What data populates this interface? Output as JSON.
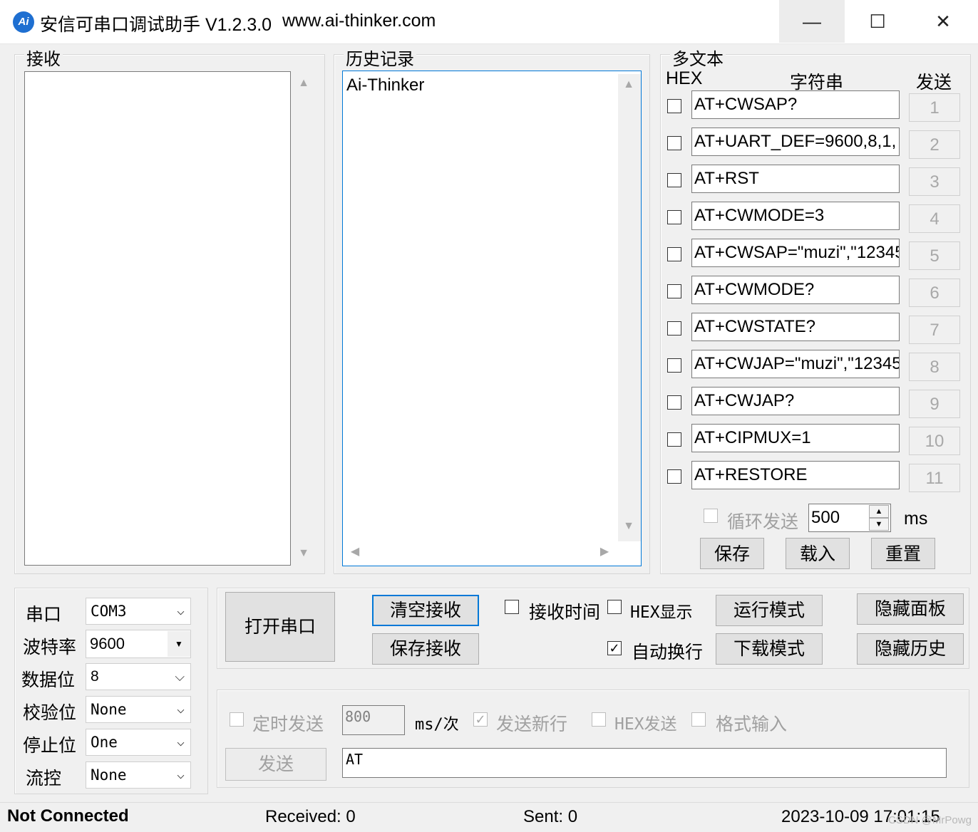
{
  "window": {
    "title": "安信可串口调试助手 V1.2.3.0",
    "url": "www.ai-thinker.com",
    "icon_text": "Ai",
    "minimize_glyph": "—",
    "maximize_glyph": "☐",
    "close_glyph": "✕"
  },
  "receive": {
    "legend": "接收",
    "content": ""
  },
  "history": {
    "legend": "历史记录",
    "content": "Ai-Thinker"
  },
  "multi_text": {
    "legend": "多文本",
    "hex_header": "HEX",
    "string_header": "字符串",
    "send_header": "发送",
    "rows": [
      {
        "cmd": "AT+CWSAP?",
        "num": "1"
      },
      {
        "cmd": "AT+UART_DEF=9600,8,1,",
        "num": "2"
      },
      {
        "cmd": "AT+RST",
        "num": "3"
      },
      {
        "cmd": "AT+CWMODE=3",
        "num": "4"
      },
      {
        "cmd": "AT+CWSAP=\"muzi\",\"12345",
        "num": "5"
      },
      {
        "cmd": "AT+CWMODE?",
        "num": "6"
      },
      {
        "cmd": "AT+CWSTATE?",
        "num": "7"
      },
      {
        "cmd": "AT+CWJAP=\"muzi\",\"12345",
        "num": "8"
      },
      {
        "cmd": "AT+CWJAP?",
        "num": "9"
      },
      {
        "cmd": "AT+CIPMUX=1",
        "num": "10"
      },
      {
        "cmd": "AT+RESTORE",
        "num": "11"
      }
    ],
    "loop_send_label": "循环发送",
    "loop_interval": "500",
    "loop_unit": "ms",
    "save_btn": "保存",
    "load_btn": "载入",
    "reset_btn": "重置"
  },
  "port_settings": {
    "port_label": "串口",
    "port_value": "COM3",
    "baud_label": "波特率",
    "baud_value": "9600",
    "databits_label": "数据位",
    "databits_value": "8",
    "parity_label": "校验位",
    "parity_value": "None",
    "stopbits_label": "停止位",
    "stopbits_value": "One",
    "flow_label": "流控",
    "flow_value": "None"
  },
  "controls": {
    "open_port_btn": "打开串口",
    "clear_receive_btn": "清空接收",
    "save_receive_btn": "保存接收",
    "receive_time_label": "接收时间",
    "receive_time_checked": false,
    "hex_display_label": "HEX显示",
    "hex_display_checked": false,
    "auto_newline_label": "自动换行",
    "auto_newline_checked": true,
    "run_mode_btn": "运行模式",
    "download_mode_btn": "下载模式",
    "hide_panel_btn": "隐藏面板",
    "hide_history_btn": "隐藏历史"
  },
  "send_area": {
    "timed_send_label": "定时发送",
    "timed_interval": "800",
    "timed_unit": "ms/次",
    "send_newline_label": "发送新行",
    "send_newline_checked": true,
    "hex_send_label": "HEX发送",
    "format_input_label": "格式输入",
    "send_btn": "发送",
    "send_text": "AT"
  },
  "status": {
    "connection": "Not Connected",
    "received": "Received: 0",
    "sent": "Sent: 0",
    "datetime": "2023-10-09 17:01:15",
    "watermark": "CSDN @MrPowg"
  },
  "colors": {
    "accent": "#0078d7",
    "icon_bg": "#1e6fd1"
  },
  "icons": {
    "up": "▲",
    "down": "▼",
    "left": "◀",
    "right": "▶",
    "combo_arrow": "⌵",
    "check": "✓"
  }
}
